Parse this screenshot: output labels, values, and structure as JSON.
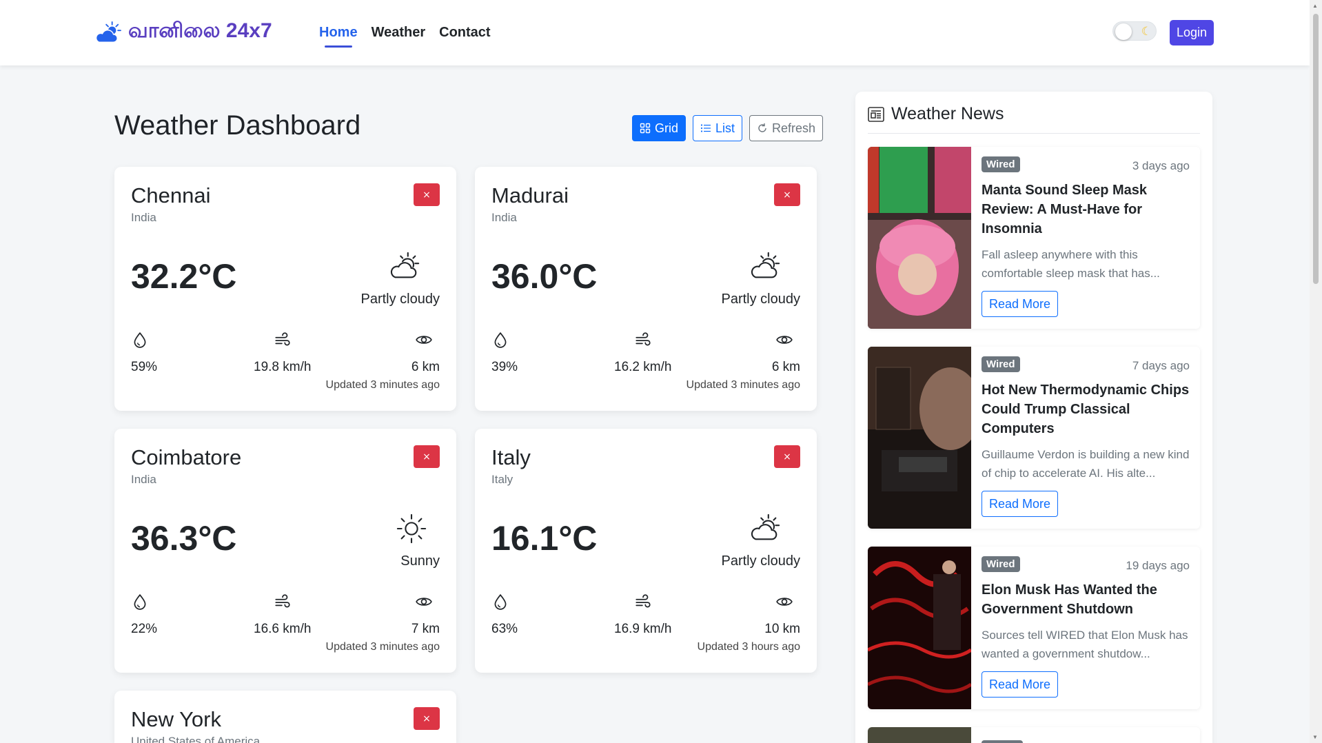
{
  "brand": {
    "name": "வானிலை 24x7"
  },
  "nav": {
    "links": [
      "Home",
      "Weather",
      "Contact"
    ],
    "login": "Login"
  },
  "main": {
    "title": "Weather Dashboard",
    "view_buttons": {
      "grid": "Grid",
      "list": "List",
      "refresh": "Refresh"
    }
  },
  "cities": [
    {
      "city": "Chennai",
      "country": "India",
      "temp": "32.2°C",
      "condition": "Partly cloudy",
      "icon": "partly-cloudy-icon",
      "humidity": "59%",
      "wind": "19.8 km/h",
      "visibility": "6 km",
      "updated": "Updated 3 minutes ago"
    },
    {
      "city": "Madurai",
      "country": "India",
      "temp": "36.0°C",
      "condition": "Partly cloudy",
      "icon": "partly-cloudy-icon",
      "humidity": "39%",
      "wind": "16.2 km/h",
      "visibility": "6 km",
      "updated": "Updated 3 minutes ago"
    },
    {
      "city": "Coimbatore",
      "country": "India",
      "temp": "36.3°C",
      "condition": "Sunny",
      "icon": "sun-icon",
      "humidity": "22%",
      "wind": "16.6 km/h",
      "visibility": "7 km",
      "updated": "Updated 3 minutes ago"
    },
    {
      "city": "Italy",
      "country": "Italy",
      "temp": "16.1°C",
      "condition": "Partly cloudy",
      "icon": "partly-cloudy-icon",
      "humidity": "63%",
      "wind": "16.9 km/h",
      "visibility": "10 km",
      "updated": "Updated 3 hours ago"
    },
    {
      "city": "New York",
      "country": "United States of America"
    }
  ],
  "close_symbol": "×",
  "news": {
    "title": "Weather News",
    "read_more": "Read More",
    "items": [
      {
        "source": "Wired",
        "ago": "3 days ago",
        "headline": "Manta Sound Sleep Mask Review: A Must-Have for Insomnia",
        "summary": "Fall asleep anywhere with this comfortable sleep mask that has..."
      },
      {
        "source": "Wired",
        "ago": "7 days ago",
        "headline": "Hot New Thermodynamic Chips Could Trump Classical Computers",
        "summary": "Guillaume Verdon is building a new kind of chip to accelerate AI. His alte..."
      },
      {
        "source": "Wired",
        "ago": "19 days ago",
        "headline": "Elon Musk Has Wanted the Government Shutdown",
        "summary": "Sources tell WIRED that Elon Musk has wanted a government shutdow..."
      }
    ]
  }
}
